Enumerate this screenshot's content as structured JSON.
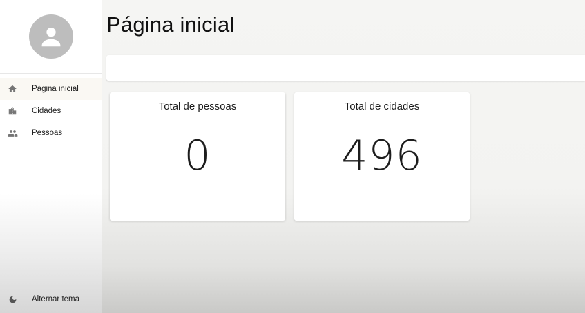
{
  "sidebar": {
    "avatar_icon": "person-icon",
    "items": [
      {
        "label": "Página inicial",
        "icon": "home-icon",
        "active": true
      },
      {
        "label": "Cidades",
        "icon": "city-icon",
        "active": false
      },
      {
        "label": "Pessoas",
        "icon": "people-icon",
        "active": false
      }
    ],
    "theme_toggle": {
      "label": "Alternar tema",
      "icon": "moon-icon"
    }
  },
  "main": {
    "title": "Página inicial",
    "cards": [
      {
        "title": "Total de pessoas",
        "value": "0"
      },
      {
        "title": "Total de cidades",
        "value": "496"
      }
    ]
  },
  "colors": {
    "sidebar_bg": "#ffffff",
    "main_bg": "#f4f4f2",
    "icon_gray": "#757575",
    "avatar_gray": "#bdbdbd"
  }
}
